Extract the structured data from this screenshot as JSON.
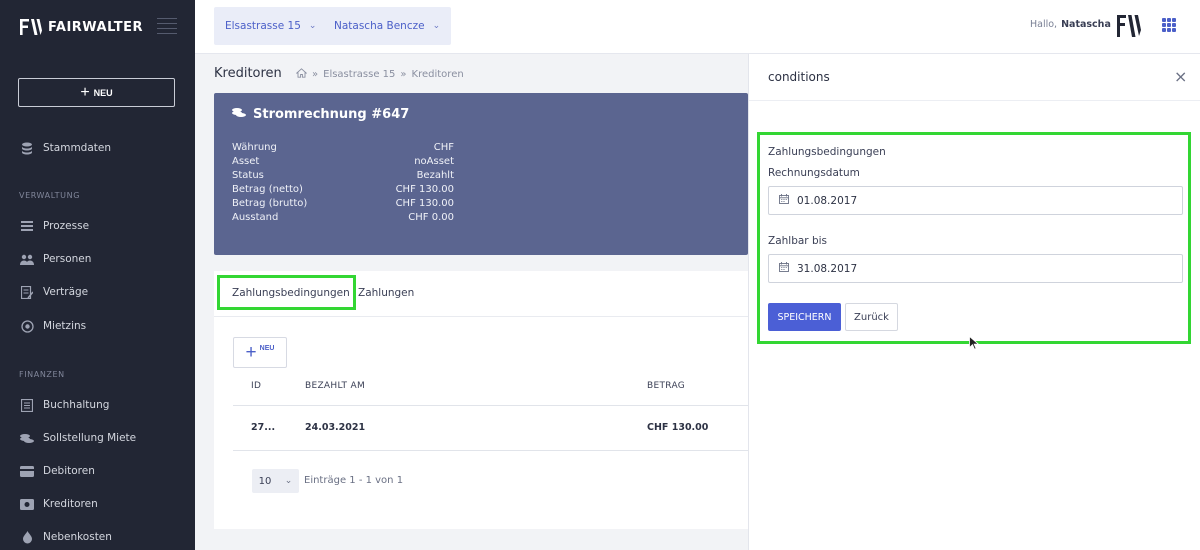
{
  "brand": {
    "name": "FAIRWALTER"
  },
  "sidebar": {
    "new_label": "NEU",
    "stammdaten": "Stammdaten",
    "section_verwaltung": "VERWALTUNG",
    "verwaltung_items": [
      {
        "label": "Prozesse",
        "icon": "process-icon"
      },
      {
        "label": "Personen",
        "icon": "people-icon"
      },
      {
        "label": "Verträge",
        "icon": "contract-icon"
      },
      {
        "label": "Mietzins",
        "icon": "rent-icon"
      }
    ],
    "section_finanzen": "FINANZEN",
    "finanzen_items": [
      {
        "label": "Buchhaltung",
        "icon": "ledger-icon"
      },
      {
        "label": "Sollstellung Miete",
        "icon": "coins-icon"
      },
      {
        "label": "Debitoren",
        "icon": "debtor-icon"
      },
      {
        "label": "Kreditoren",
        "icon": "creditor-icon"
      },
      {
        "label": "Nebenkosten",
        "icon": "utility-icon"
      }
    ]
  },
  "header": {
    "property_selector": "Elsastrasse 15",
    "person_selector": "Natascha Bencze",
    "greeting": "Hallo,",
    "user_name": "Natascha"
  },
  "page": {
    "title": "Kreditoren",
    "breadcrumb": [
      "Elsastrasse 15",
      "Kreditoren"
    ]
  },
  "invoice": {
    "title": "Stromrechnung #647",
    "fields": [
      {
        "label": "Währung",
        "value": "CHF"
      },
      {
        "label": "Asset",
        "value": "noAsset"
      },
      {
        "label": "Status",
        "value": "Bezahlt"
      },
      {
        "label": "Betrag (netto)",
        "value": "CHF 130.00"
      },
      {
        "label": "Betrag (brutto)",
        "value": "CHF 130.00"
      },
      {
        "label": "Ausstand",
        "value": "CHF 0.00"
      }
    ]
  },
  "tabs": {
    "zahlungsbedingungen": "Zahlungsbedingungen",
    "zahlungen": "Zahlungen"
  },
  "table": {
    "new_label": "NEU",
    "headers": {
      "id": "ID",
      "paid_at": "BEZAHLT AM",
      "amount": "BETRAG"
    },
    "rows": [
      {
        "id": "27...",
        "paid_at": "24.03.2021",
        "amount": "CHF 130.00"
      }
    ],
    "page_size": "10",
    "entries_text": "Einträge 1 - 1 von 1"
  },
  "drawer": {
    "title": "conditions",
    "section_title": "Zahlungsbedingungen",
    "invoice_date_label": "Rechnungsdatum",
    "invoice_date_value": "01.08.2017",
    "due_date_label": "Zahlbar bis",
    "due_date_value": "31.08.2017",
    "save_label": "SPEICHERN",
    "back_label": "Zurück"
  },
  "colors": {
    "sidebar_bg": "#222634",
    "accent": "#4b5fd6",
    "invoice_card_bg": "#5b6590",
    "highlight": "#33d633"
  }
}
